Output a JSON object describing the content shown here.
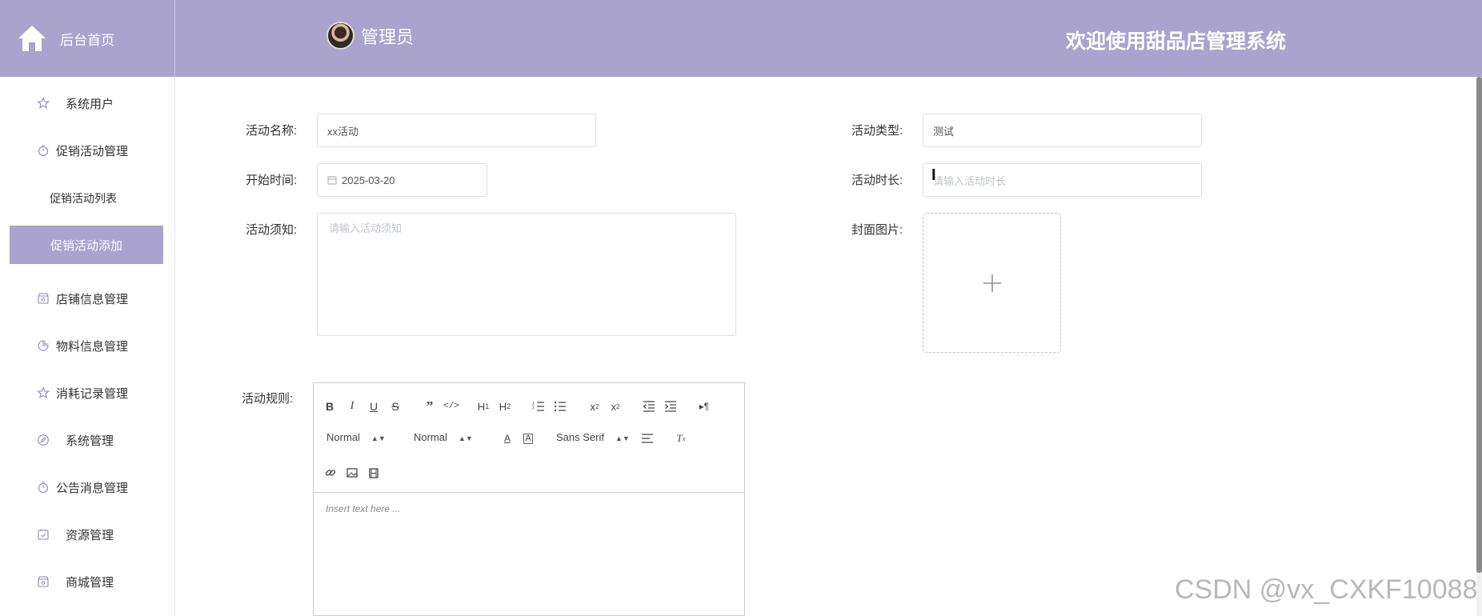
{
  "header": {
    "home_label": "后台首页",
    "admin_name": "管理员",
    "welcome": "欢迎使用甜品店管理系统",
    "bg_color": "#a9a3cd"
  },
  "sidebar": {
    "items": [
      {
        "label": "系统用户",
        "icon": "star-icon"
      },
      {
        "label": "促销活动管理",
        "icon": "timer-icon"
      },
      {
        "label": "店铺信息管理",
        "icon": "store-icon"
      },
      {
        "label": "物料信息管理",
        "icon": "pie-icon"
      },
      {
        "label": "消耗记录管理",
        "icon": "star-icon"
      },
      {
        "label": "系统管理",
        "icon": "compass-icon"
      },
      {
        "label": "公告消息管理",
        "icon": "timer-icon"
      },
      {
        "label": "资源管理",
        "icon": "calendar-check-icon"
      },
      {
        "label": "商城管理",
        "icon": "store-icon"
      }
    ],
    "submenu": {
      "list_label": "促销活动列表",
      "add_label": "促销活动添加"
    }
  },
  "form": {
    "name_label": "活动名称:",
    "name_value": "xx活动",
    "type_label": "活动类型:",
    "type_value": "测试",
    "start_label": "开始时间:",
    "start_value": "2025-03-20",
    "duration_label": "活动时长:",
    "duration_placeholder": "请输入活动时长",
    "notice_label": "活动须知:",
    "notice_placeholder": "请输入活动须知",
    "cover_label": "封面图片:",
    "rules_label": "活动规则:"
  },
  "editor": {
    "header_select": "Normal",
    "size_select": "Normal",
    "font_select": "Sans Serif",
    "placeholder": "Insert text here ..."
  },
  "watermark": "CSDN @vx_CXKF10088"
}
